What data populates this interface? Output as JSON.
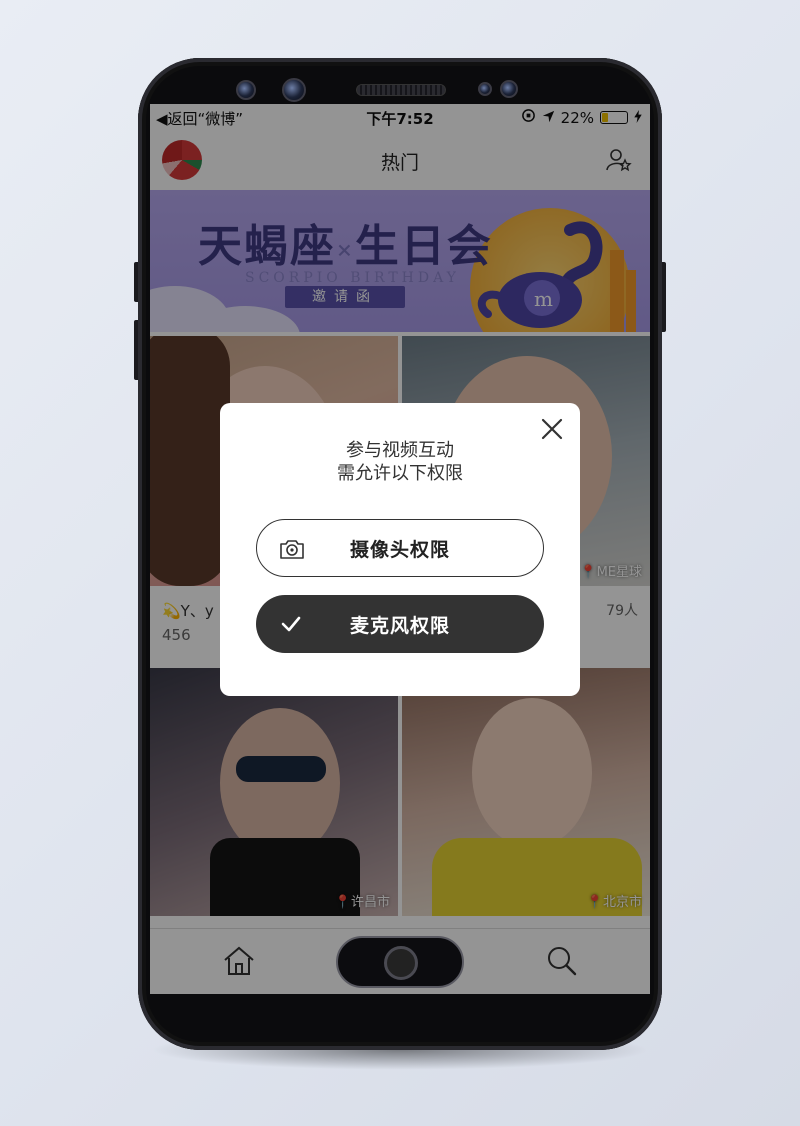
{
  "status_bar": {
    "back_app": "◀返回“微博”",
    "time": "下午7:52",
    "battery": "22%"
  },
  "nav": {
    "title": "热门"
  },
  "banner": {
    "title_left": "天蝎座",
    "title_x": "×",
    "title_right": "生日会",
    "subtitle": "SCORPIO BIRTHDAY",
    "invite": "邀请函"
  },
  "cards": [
    {
      "location": "",
      "name": "💫Y、y",
      "count": "456"
    },
    {
      "location": "ME星球",
      "viewers": "79人"
    },
    {
      "location": "许昌市"
    },
    {
      "location": "北京市"
    }
  ],
  "modal": {
    "message_line1": "参与视频互动",
    "message_line2": "需允许以下权限",
    "camera_label": "摄像头权限",
    "mic_label": "麦克风权限"
  }
}
